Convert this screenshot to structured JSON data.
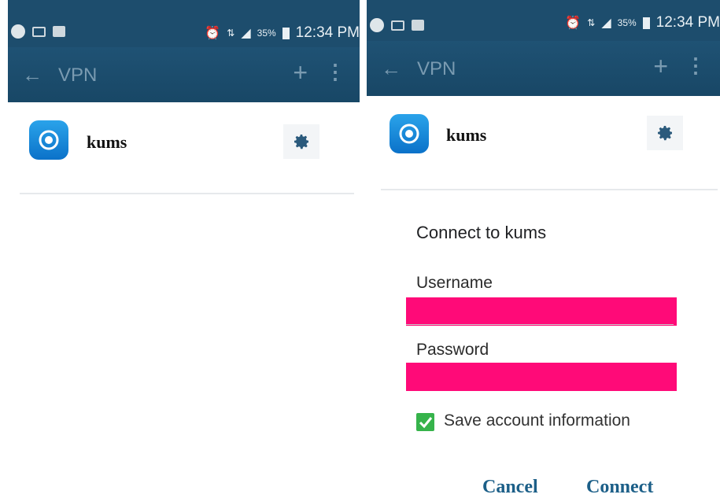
{
  "status_bar": {
    "battery": "35%",
    "time": "12:34 PM"
  },
  "action_bar": {
    "back_glyph": "←",
    "title": "VPN",
    "add_glyph": "+",
    "more_glyph": "⋮"
  },
  "vpn_profile": {
    "name": "kums"
  },
  "dialog": {
    "title": "Connect to kums",
    "username_label": "Username",
    "username_value": "",
    "password_label": "Password",
    "password_value": "",
    "save_label": "Save account information",
    "save_checked": true,
    "cancel_label": "Cancel",
    "connect_label": "Connect"
  },
  "colors": {
    "header": "#1d4d6d",
    "accent": "#1c5f88",
    "redaction": "#ff0a78",
    "checkbox": "#36b34b"
  },
  "icons": [
    "status-app-icon",
    "mail-icon",
    "sim-icon",
    "alarm-icon",
    "data-icon",
    "signal-icon",
    "battery-icon",
    "back-arrow-icon",
    "add-icon",
    "more-vert-icon",
    "vpn-app-icon",
    "gear-icon",
    "check-icon"
  ]
}
